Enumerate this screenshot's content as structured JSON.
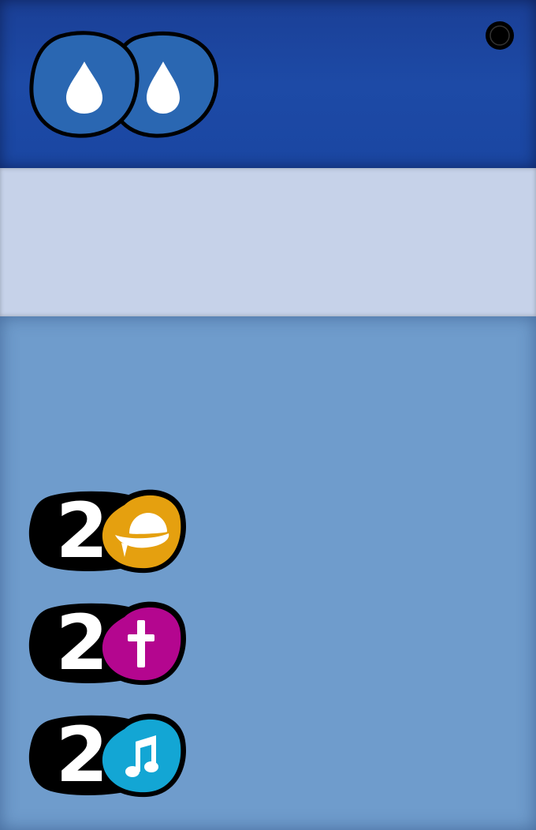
{
  "card": {
    "header": {
      "cost": [
        {
          "icon": "water-drop-icon",
          "color": "#2a68b3"
        },
        {
          "icon": "water-drop-icon",
          "color": "#2a68b3"
        }
      ],
      "marker_icon": "black-dot-icon"
    },
    "abilities": [
      {
        "value": "2",
        "icon": "bowler-hat-icon",
        "color": "#e5a00f"
      },
      {
        "value": "2",
        "icon": "cross-icon",
        "color": "#b4068f"
      },
      {
        "value": "2",
        "icon": "music-note-icon",
        "color": "#13a6d4"
      }
    ]
  }
}
